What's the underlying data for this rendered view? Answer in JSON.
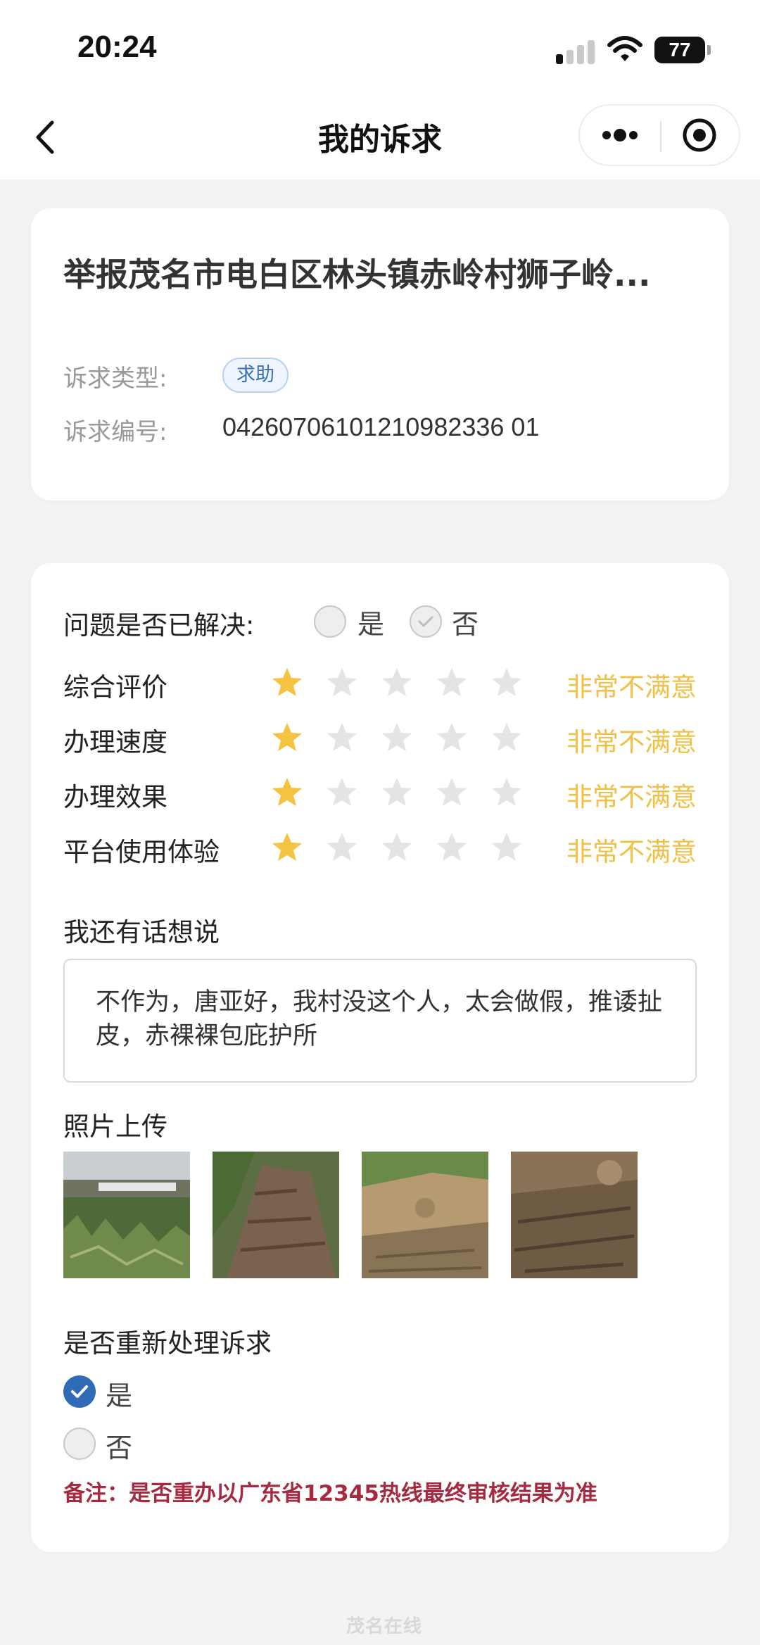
{
  "status_bar": {
    "time": "20:24",
    "battery": "77"
  },
  "nav": {
    "title": "我的诉求"
  },
  "report": {
    "title": "举报茂名市电白区林头镇赤岭村狮子岭...",
    "type_label": "诉求类型:",
    "type_value": "求助",
    "number_label": "诉求编号:",
    "number_value": "04260706101210982336 01"
  },
  "evaluation": {
    "resolved_question": "问题是否已解决:",
    "resolved_options": [
      {
        "label": "是",
        "selected": false
      },
      {
        "label": "否",
        "selected": true
      }
    ],
    "ratings": [
      {
        "label": "综合评价",
        "stars": 1,
        "max": 5,
        "text": "非常不满意"
      },
      {
        "label": "办理速度",
        "stars": 1,
        "max": 5,
        "text": "非常不满意"
      },
      {
        "label": "办理效果",
        "stars": 1,
        "max": 5,
        "text": "非常不满意"
      },
      {
        "label": "平台使用体验",
        "stars": 1,
        "max": 5,
        "text": "非常不满意"
      }
    ],
    "comment_label": "我还有话想说",
    "comment_text": "不作为，唐亚好，我村没这个人，太会做假，推诿扯皮，赤裸裸包庇护所",
    "photo_label": "照片上传",
    "reprocess_label": "是否重新处理诉求",
    "reprocess_options": [
      {
        "label": "是",
        "selected": true
      },
      {
        "label": "否",
        "selected": false
      }
    ],
    "note": "备注：是否重办以广东省12345热线最终审核结果为准"
  },
  "watermark": "茂名在线",
  "colors": {
    "star_active": "#f5c342",
    "star_inactive": "#e4e4e4",
    "rating_text": "#f0c147",
    "accent_blue": "#2f6bb7",
    "note_red": "#a62a3f"
  }
}
